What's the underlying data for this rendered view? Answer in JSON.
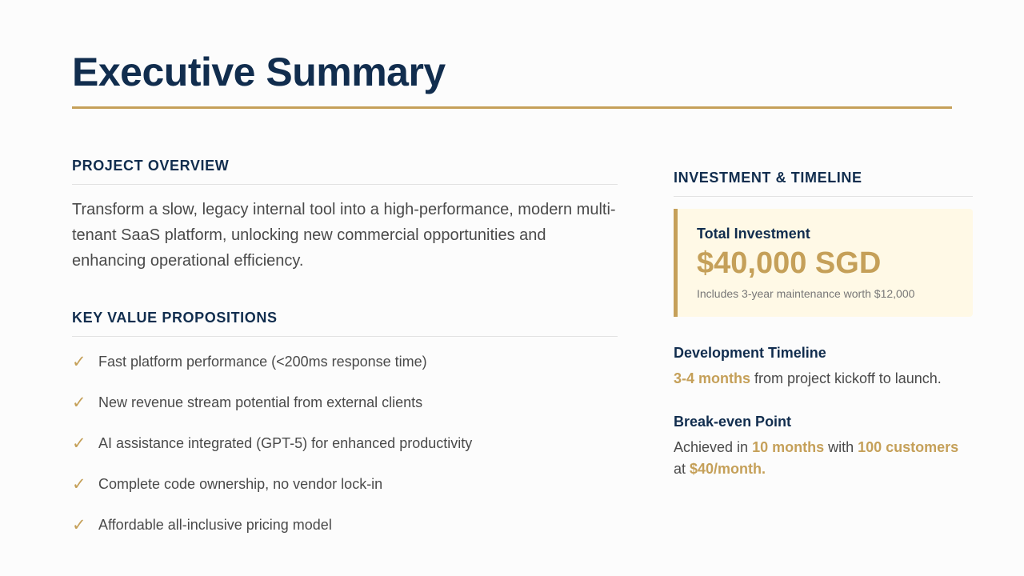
{
  "title": "Executive Summary",
  "overview": {
    "heading": "PROJECT OVERVIEW",
    "text": "Transform a slow, legacy internal tool into a high-performance, modern multi-tenant SaaS platform, unlocking new commercial opportunities and enhancing operational efficiency."
  },
  "value_props": {
    "heading": "KEY VALUE PROPOSITIONS",
    "check_glyph": "✓",
    "items": [
      "Fast platform performance (<200ms response time)",
      "New revenue stream potential from external clients",
      "AI assistance integrated (GPT-5) for enhanced productivity",
      "Complete code ownership, no vendor lock-in",
      "Affordable all-inclusive pricing model"
    ]
  },
  "investment": {
    "heading": "INVESTMENT & TIMELINE",
    "total_label": "Total Investment",
    "amount": "$40,000 SGD",
    "note": "Includes 3-year maintenance worth $12,000"
  },
  "timeline": {
    "heading": "Development Timeline",
    "highlight": "3-4 months",
    "rest": " from project kickoff to launch."
  },
  "breakeven": {
    "heading": "Break-even Point",
    "p1": "Achieved in ",
    "h1": "10 months",
    "p2": " with ",
    "h2": "100 customers",
    "p3": " at ",
    "h3": "$40/month."
  },
  "colors": {
    "navy": "#112d4e",
    "gold": "#c5a059",
    "highlight_bg": "#fff9e6"
  }
}
